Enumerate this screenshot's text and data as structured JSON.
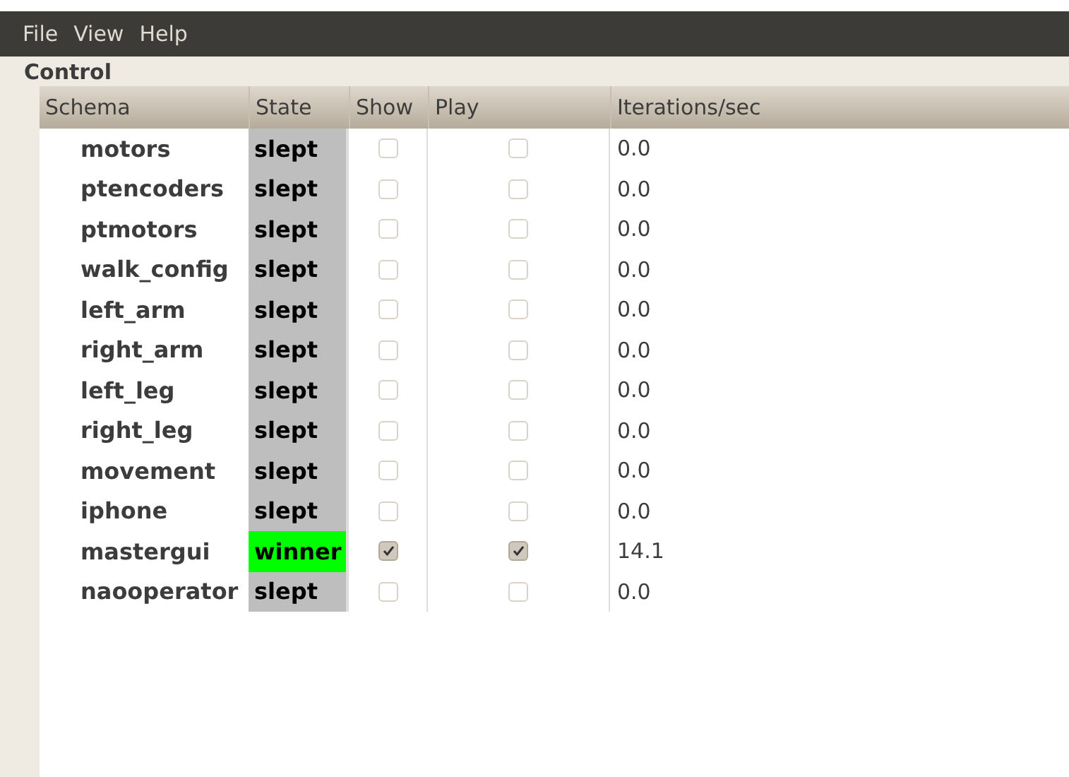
{
  "menu": [
    "File",
    "View",
    "Help"
  ],
  "panel": {
    "title": "Control"
  },
  "table": {
    "columns": [
      "Schema",
      "State",
      "Show",
      "Play",
      "Iterations/sec"
    ],
    "rows": [
      {
        "schema": "motors",
        "state": "slept",
        "color": "#bebebe",
        "show": false,
        "play": false,
        "rate": "0.0"
      },
      {
        "schema": "ptencoders",
        "state": "slept",
        "color": "#bebebe",
        "show": false,
        "play": false,
        "rate": "0.0"
      },
      {
        "schema": "ptmotors",
        "state": "slept",
        "color": "#bebebe",
        "show": false,
        "play": false,
        "rate": "0.0"
      },
      {
        "schema": "walk_config",
        "state": "slept",
        "color": "#bebebe",
        "show": false,
        "play": false,
        "rate": "0.0"
      },
      {
        "schema": "left_arm",
        "state": "slept",
        "color": "#bebebe",
        "show": false,
        "play": false,
        "rate": "0.0"
      },
      {
        "schema": "right_arm",
        "state": "slept",
        "color": "#bebebe",
        "show": false,
        "play": false,
        "rate": "0.0"
      },
      {
        "schema": "left_leg",
        "state": "slept",
        "color": "#bebebe",
        "show": false,
        "play": false,
        "rate": "0.0"
      },
      {
        "schema": "right_leg",
        "state": "slept",
        "color": "#bebebe",
        "show": false,
        "play": false,
        "rate": "0.0"
      },
      {
        "schema": "movement",
        "state": "slept",
        "color": "#bebebe",
        "show": false,
        "play": false,
        "rate": "0.0"
      },
      {
        "schema": "iphone",
        "state": "slept",
        "color": "#bebebe",
        "show": false,
        "play": false,
        "rate": "0.0"
      },
      {
        "schema": "mastergui",
        "state": "winner",
        "color": "#00ff00",
        "show": true,
        "play": true,
        "rate": "14.1"
      },
      {
        "schema": "naooperator",
        "state": "slept",
        "color": "#bebebe",
        "show": false,
        "play": false,
        "rate": "0.0"
      }
    ]
  }
}
